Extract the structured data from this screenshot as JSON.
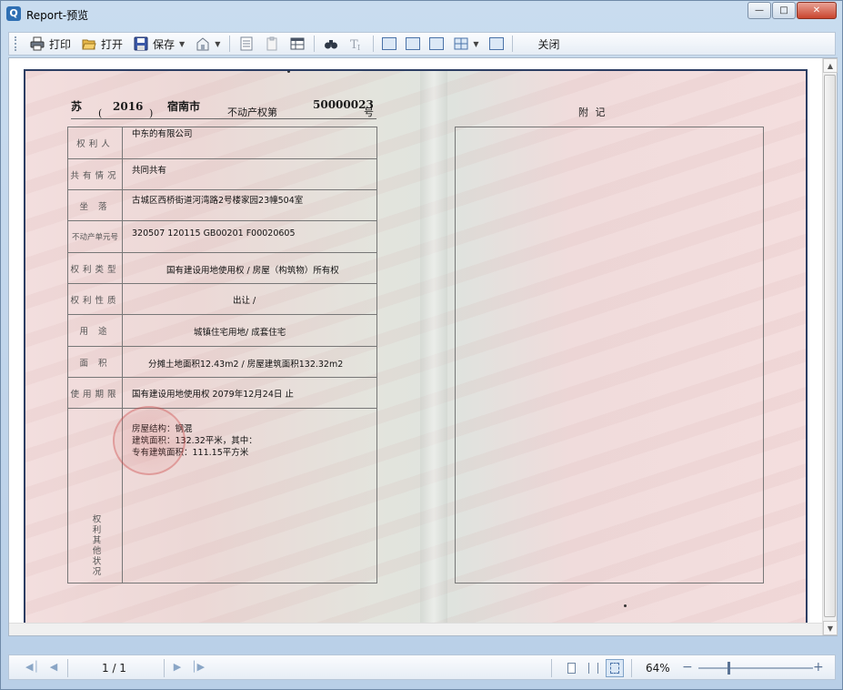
{
  "window": {
    "title": "Report-预览"
  },
  "toolbar": {
    "print_label": "打印",
    "open_label": "打开",
    "save_label": "保存",
    "close_label": "关闭"
  },
  "certificate": {
    "province": "苏",
    "year": "2016",
    "city": "宿南市",
    "cert_word": "不动产权第",
    "cert_number": "50000023",
    "cert_suffix": "号",
    "appendix_title": "附    记",
    "rows": [
      {
        "label": "权利人",
        "value": "中东的有限公司"
      },
      {
        "label": "共有情况",
        "value": "共同共有"
      },
      {
        "label": "坐   落",
        "value": "古城区西桥街道河湾路2号楼家园23幢504室"
      },
      {
        "label": "不动产单元号",
        "value": "320507 120115 GB00201 F00020605"
      },
      {
        "label": "权利类型",
        "value": "国有建设用地使用权 / 房屋（构筑物）所有权"
      },
      {
        "label": "权利性质",
        "value": "出让 /"
      },
      {
        "label": "用   途",
        "value": "城镇住宅用地/   成套住宅"
      },
      {
        "label": "面   积",
        "value": "分摊土地面积12.43m2 /   房屋建筑面积132.32m2"
      },
      {
        "label": "使用期限",
        "value": "国有建设用地使用权 2079年12月24日 止"
      }
    ],
    "other_label": "权利其他状况",
    "other_lines": [
      "房屋结构：钢混",
      "建筑面积：132.32平米，其中：",
      "专有建筑面积：111.15平方米"
    ]
  },
  "statusbar": {
    "page_info": "1 / 1",
    "zoom": "64%",
    "zoom_level": 0.64
  }
}
